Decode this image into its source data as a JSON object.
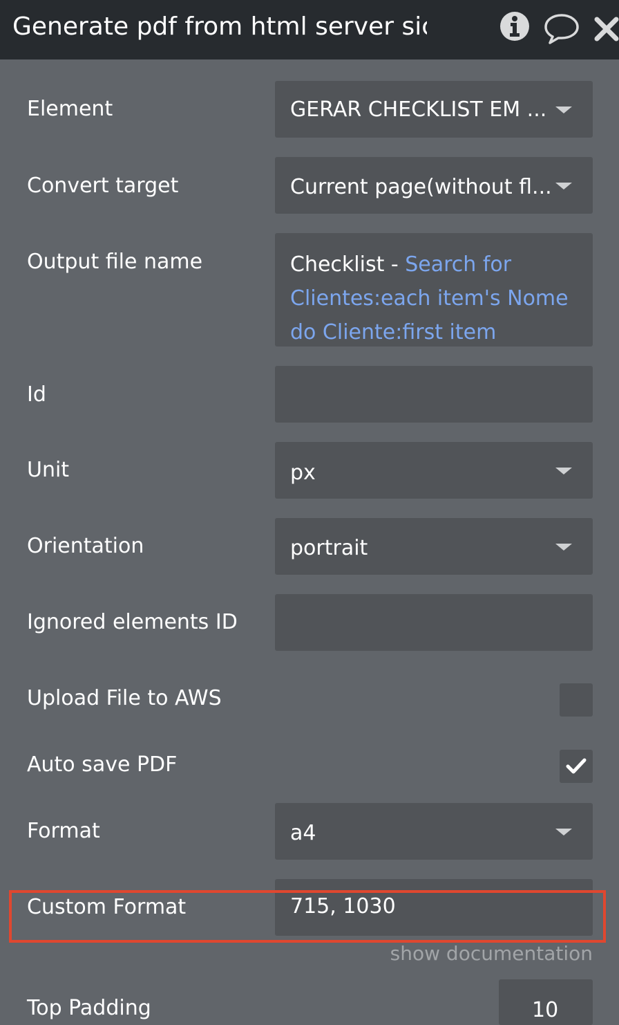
{
  "header": {
    "title": "Generate pdf from html server sic",
    "icons": [
      "info-icon",
      "comment-icon",
      "close-icon"
    ]
  },
  "fields": {
    "element": {
      "label": "Element",
      "value": "GERAR CHECKLIST EM ..."
    },
    "convert_target": {
      "label": "Convert target",
      "value": "Current page(without fl..."
    },
    "output_file_name": {
      "label": "Output file name",
      "static_text": "Checklist - ",
      "dynamic_text": "Search for Clientes:each item's Nome do Cliente:first item"
    },
    "id": {
      "label": "Id",
      "value": ""
    },
    "unit": {
      "label": "Unit",
      "value": "px"
    },
    "orientation": {
      "label": "Orientation",
      "value": "portrait"
    },
    "ignored_elements": {
      "label": "Ignored elements ID",
      "value": ""
    },
    "upload_aws": {
      "label": "Upload File to AWS",
      "checked": false
    },
    "auto_save": {
      "label": "Auto save PDF",
      "checked": true
    },
    "format": {
      "label": "Format",
      "value": "a4"
    },
    "custom_format": {
      "label": "Custom Format",
      "value": "715, 1030"
    },
    "show_documentation": "show documentation",
    "top_padding": {
      "label": "Top Padding",
      "value": "10"
    }
  },
  "colors": {
    "panel_bg": "#61656a",
    "header_bg": "#272b2f",
    "field_bg": "#515458",
    "dynamic_text": "#7ca6ee",
    "highlight": "#e0472f"
  }
}
